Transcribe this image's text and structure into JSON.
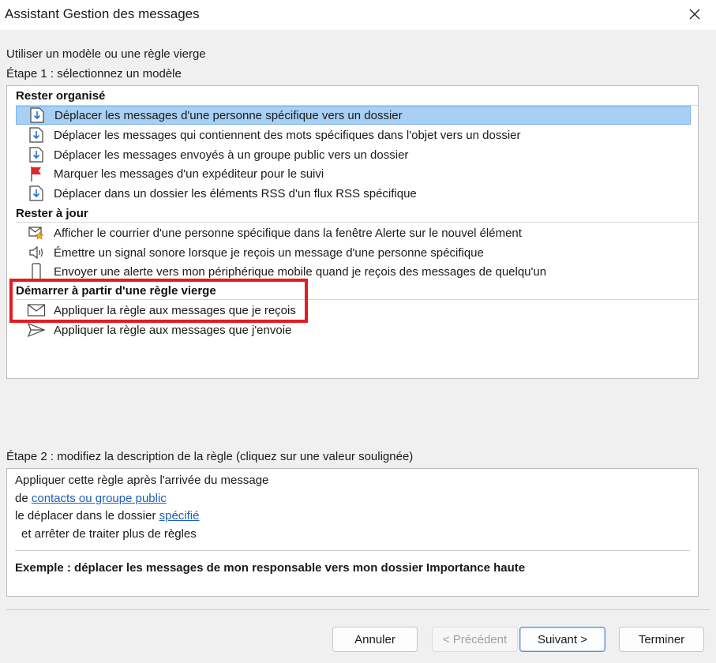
{
  "window": {
    "title": "Assistant Gestion des messages"
  },
  "intro": "Utiliser un modèle ou une règle vierge",
  "step1_label": "Étape 1 : sélectionnez un modèle",
  "sections": {
    "organise": {
      "header": "Rester organisé",
      "items": [
        {
          "label": "Déplacer les messages d'une personne spécifique vers un dossier",
          "icon": "move-to-folder-icon",
          "selected": true
        },
        {
          "label": "Déplacer les messages qui contiennent des mots spécifiques dans l'objet vers un dossier",
          "icon": "move-to-folder-icon"
        },
        {
          "label": "Déplacer les messages envoyés à un groupe public vers un dossier",
          "icon": "move-to-folder-icon"
        },
        {
          "label": "Marquer les messages d'un expéditeur pour le suivi",
          "icon": "red-flag-icon"
        },
        {
          "label": "Déplacer dans un dossier les éléments RSS d'un flux RSS spécifique",
          "icon": "move-to-folder-icon"
        }
      ]
    },
    "ajour": {
      "header": "Rester à jour",
      "items": [
        {
          "label": "Afficher le courrier d'une personne spécifique dans la fenêtre Alerte sur le nouvel élément",
          "icon": "mail-star-alert-icon"
        },
        {
          "label": "Émettre un signal sonore lorsque je reçois un message d'une personne spécifique",
          "icon": "speaker-icon"
        },
        {
          "label": "Envoyer une alerte vers mon périphérique mobile quand je reçois des messages de quelqu'un",
          "icon": "mobile-phone-icon"
        }
      ]
    },
    "vierge": {
      "header": "Démarrer à partir d'une règle vierge",
      "items": [
        {
          "label": "Appliquer la règle aux messages que je reçois",
          "icon": "envelope-icon"
        },
        {
          "label": "Appliquer la règle aux messages que j'envoie",
          "icon": "send-icon"
        }
      ]
    }
  },
  "step2_label": "Étape 2 : modifiez la description de la règle (cliquez sur une valeur soulignée)",
  "description": {
    "line1": "Appliquer cette règle après l'arrivée du message",
    "line2_prefix": "de ",
    "line2_link": "contacts ou groupe public",
    "line3_prefix": "le déplacer dans le dossier ",
    "line3_link": "spécifié",
    "line4": "et arrêter de traiter plus de règles",
    "example": "Exemple : déplacer les messages de mon responsable vers mon dossier Importance haute"
  },
  "buttons": {
    "cancel": "Annuler",
    "previous": "< Précédent",
    "next": "Suivant >",
    "finish": "Terminer"
  },
  "colors": {
    "selection": "#a8d0f4",
    "highlight_border": "#e31b23",
    "link": "#1f5fb5"
  }
}
